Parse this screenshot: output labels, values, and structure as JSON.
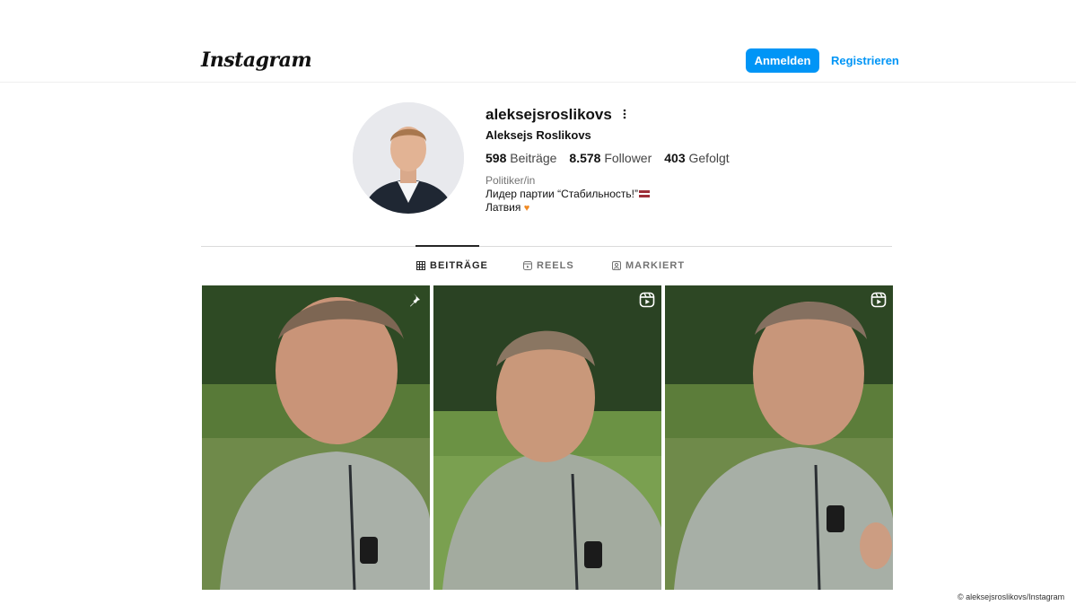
{
  "header": {
    "logo_text": "Instagram",
    "login_label": "Anmelden",
    "register_label": "Registrieren",
    "accent_color": "#0095f6"
  },
  "profile": {
    "username": "aleksejsroslikovs",
    "full_name": "Aleksejs Roslikovs",
    "posts_count": "598",
    "posts_label": "Beiträge",
    "followers_count": "8.578",
    "followers_label": "Follower",
    "following_count": "403",
    "following_label": "Gefolgt",
    "category": "Politiker/in",
    "bio_line1": "Лидер партии “Стабильность!”",
    "bio_line2": "Латвия",
    "bio_line1_emoji": "latvia-flag",
    "bio_line2_emoji": "orange-heart"
  },
  "tabs": [
    {
      "label": "BEITRÄGE",
      "icon": "grid-icon",
      "active": true
    },
    {
      "label": "REELS",
      "icon": "reels-icon",
      "active": false
    },
    {
      "label": "MARKIERT",
      "icon": "tagged-icon",
      "active": false
    }
  ],
  "posts": [
    {
      "badge": "pin-icon"
    },
    {
      "badge": "reel-icon"
    },
    {
      "badge": "reel-icon"
    }
  ],
  "credit": "© aleksejsroslikovs/Instagram"
}
